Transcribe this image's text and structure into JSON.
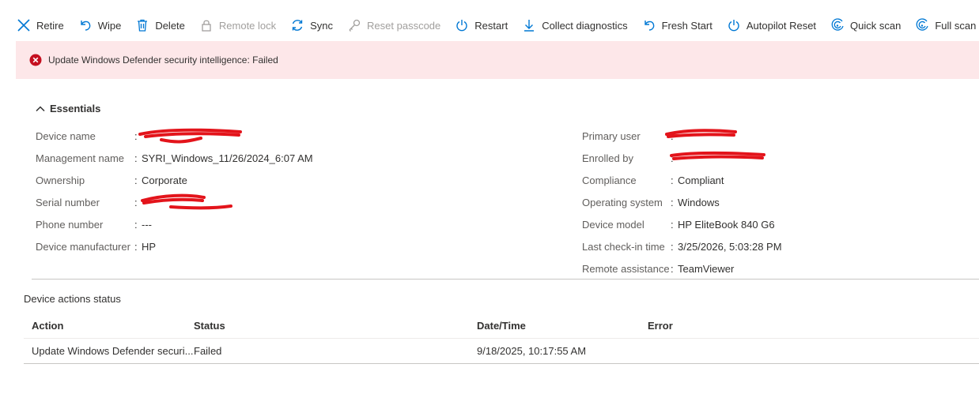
{
  "toolbar": {
    "retire": "Retire",
    "wipe": "Wipe",
    "delete": "Delete",
    "remote_lock": "Remote lock",
    "sync": "Sync",
    "reset_passcode": "Reset passcode",
    "restart": "Restart",
    "collect_diagnostics": "Collect diagnostics",
    "fresh_start": "Fresh Start",
    "autopilot_reset": "Autopilot Reset",
    "quick_scan": "Quick scan",
    "full_scan": "Full scan",
    "more": "···"
  },
  "banner": {
    "message": "Update Windows Defender security intelligence: Failed",
    "color": "#fde7e9",
    "icon_color": "#c50f1f"
  },
  "essentials": {
    "title": "Essentials",
    "left": [
      {
        "label": "Device name",
        "sep": ":",
        "value": ""
      },
      {
        "label": "Management name",
        "sep": ":",
        "value": "SYRI_Windows_11/26/2024_6:07 AM"
      },
      {
        "label": "Ownership",
        "sep": ":",
        "value": "Corporate"
      },
      {
        "label": "Serial number",
        "sep": ":",
        "value": ""
      },
      {
        "label": "Phone number",
        "sep": ":",
        "value": "---"
      },
      {
        "label": "Device manufacturer",
        "sep": ":",
        "value": "HP"
      }
    ],
    "right": [
      {
        "label": "Primary user",
        "sep": ":",
        "value": ""
      },
      {
        "label": "Enrolled by",
        "sep": ":",
        "value": ""
      },
      {
        "label": "Compliance",
        "sep": ":",
        "value": "Compliant"
      },
      {
        "label": "Operating system",
        "sep": ":",
        "value": "Windows"
      },
      {
        "label": "Device model",
        "sep": ":",
        "value": "HP EliteBook 840 G6"
      },
      {
        "label": "Last check-in time",
        "sep": ":",
        "value": "3/25/2026, 5:03:28 PM"
      },
      {
        "label": "Remote assistance",
        "sep": ":",
        "value": "TeamViewer"
      }
    ]
  },
  "actions_status": {
    "title": "Device actions status",
    "columns": [
      "Action",
      "Status",
      "Date/Time",
      "Error"
    ],
    "rows": [
      {
        "action": "Update Windows Defender securi...",
        "status": "Failed",
        "datetime": "9/18/2025, 10:17:55 AM",
        "error": ""
      }
    ]
  },
  "colors": {
    "accent": "#0078d4",
    "redaction": "#e3141b"
  }
}
